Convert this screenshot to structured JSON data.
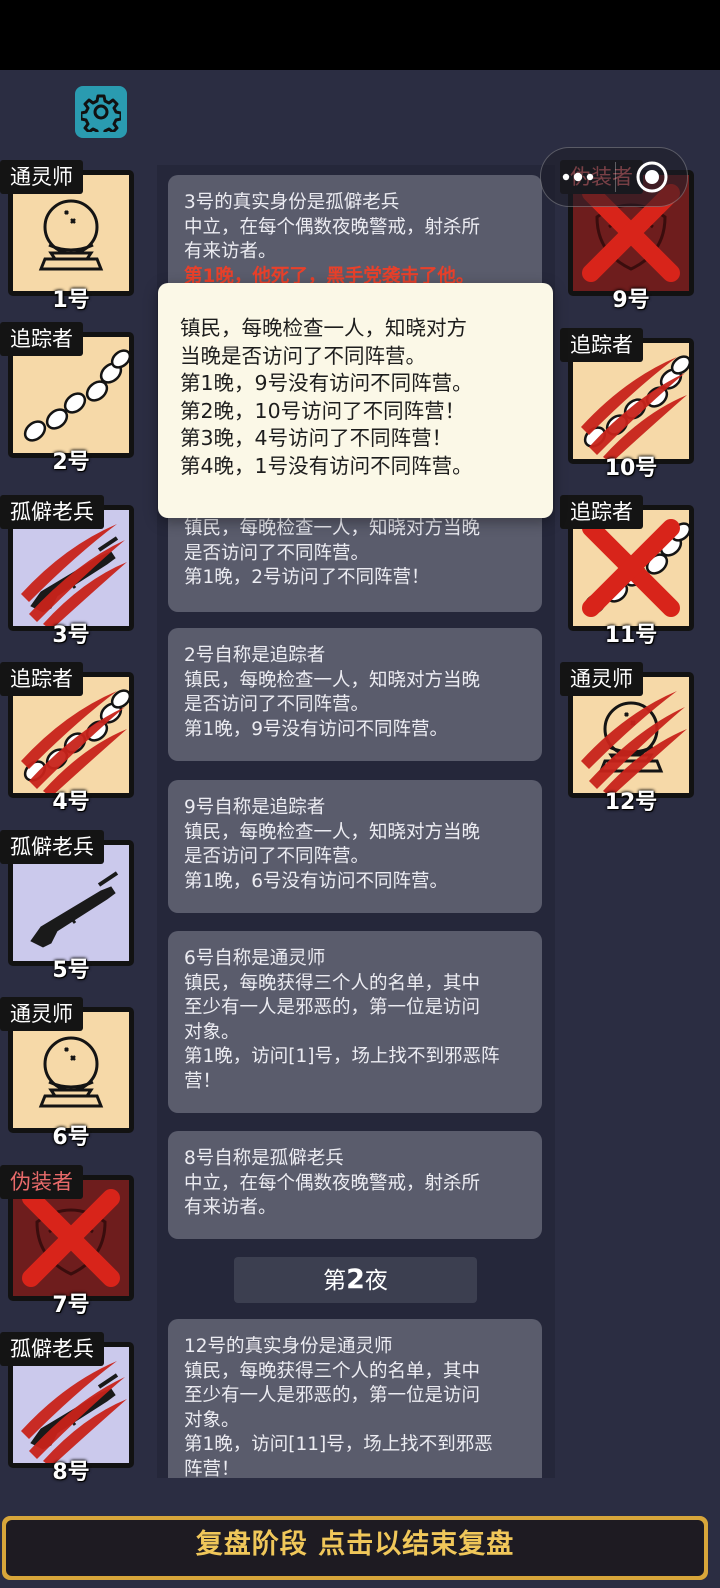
{
  "settings": {
    "icon": "gear-icon"
  },
  "capsule": {
    "icons": [
      "more-icon",
      "record-icon"
    ]
  },
  "left_players": [
    {
      "role": "通灵师",
      "number": "1号",
      "art": "crystal-ball",
      "role_color": "#ffffff",
      "status": "alive"
    },
    {
      "role": "追踪者",
      "number": "2号",
      "art": "footprints",
      "role_color": "#ffffff",
      "status": "alive"
    },
    {
      "role": "孤僻老兵",
      "number": "3号",
      "art": "rifle",
      "role_color": "#ffffff",
      "status": "killed"
    },
    {
      "role": "追踪者",
      "number": "4号",
      "art": "footprints",
      "role_color": "#ffffff",
      "status": "killed"
    },
    {
      "role": "孤僻老兵",
      "number": "5号",
      "art": "rifle",
      "role_color": "#ffffff",
      "status": "alive"
    },
    {
      "role": "通灵师",
      "number": "6号",
      "art": "crystal-ball",
      "role_color": "#ffffff",
      "status": "alive"
    },
    {
      "role": "伪装者",
      "number": "7号",
      "art": "mask",
      "role_color": "#e86a6a",
      "status": "executed"
    },
    {
      "role": "孤僻老兵",
      "number": "8号",
      "art": "rifle",
      "role_color": "#ffffff",
      "status": "killed"
    }
  ],
  "right_players": [
    {
      "role": "伪装者",
      "number": "9号",
      "art": "mask",
      "role_color": "#e86a6a",
      "status": "executed"
    },
    {
      "role": "追踪者",
      "number": "10号",
      "art": "footprints",
      "role_color": "#ffffff",
      "status": "killed"
    },
    {
      "role": "追踪者",
      "number": "11号",
      "art": "footprints",
      "role_color": "#ffffff",
      "status": "executed"
    },
    {
      "role": "通灵师",
      "number": "12号",
      "art": "crystal-ball",
      "role_color": "#ffffff",
      "status": "killed"
    }
  ],
  "log": {
    "entries": [
      {
        "lines": [
          "3号的真实身份是孤僻老兵",
          "中立，在每个偶数夜晚警戒，射杀所",
          "有来访者。"
        ],
        "alert": "第1晚，他死了，黑手党袭击了他。"
      },
      {
        "lines": [
          "镇民，每晚检查一人，知晓对方当晚",
          "是否访问了不同阵营。",
          "第1晚，2号访问了不同阵营！"
        ]
      },
      {
        "lines": [
          "2号自称是追踪者",
          "镇民，每晚检查一人，知晓对方当晚",
          "是否访问了不同阵营。",
          "第1晚，9号没有访问不同阵营。"
        ]
      },
      {
        "lines": [
          "9号自称是追踪者",
          "镇民，每晚检查一人，知晓对方当晚",
          "是否访问了不同阵营。",
          "第1晚，6号没有访问不同阵营。"
        ]
      },
      {
        "lines": [
          "6号自称是通灵师",
          "镇民，每晚获得三个人的名单，其中",
          "至少有一人是邪恶的，第一位是访问",
          "对象。",
          "第1晚，访问[1]号，场上找不到邪恶阵",
          "营！"
        ]
      },
      {
        "lines": [
          "8号自称是孤僻老兵",
          "中立，在每个偶数夜晚警戒，射杀所",
          "有来访者。"
        ]
      },
      {
        "lines": [
          "12号的真实身份是通灵师",
          "镇民，每晚获得三个人的名单，其中",
          "至少有一人是邪恶的，第一位是访问",
          "对象。",
          "第1晚，访问[11]号，场上找不到邪恶",
          "阵营！"
        ]
      }
    ],
    "night_header": {
      "prefix": "第",
      "number": "2",
      "suffix": "夜"
    }
  },
  "popup": {
    "lines": [
      "镇民，每晚检查一人，知晓对方",
      "当晚是否访问了不同阵营。",
      "第1晚，9号没有访问不同阵营。",
      "第2晚，10号访问了不同阵营！",
      "第3晚，4号访问了不同阵营！",
      "第4晚，1号没有访问不同阵营。"
    ]
  },
  "bottom_bar": {
    "label": "复盘阶段 点击以结束复盘"
  },
  "colors": {
    "accent_gold": "#d8a63a",
    "alert_red": "#e8402a",
    "gear_teal": "#2a9bb0"
  }
}
